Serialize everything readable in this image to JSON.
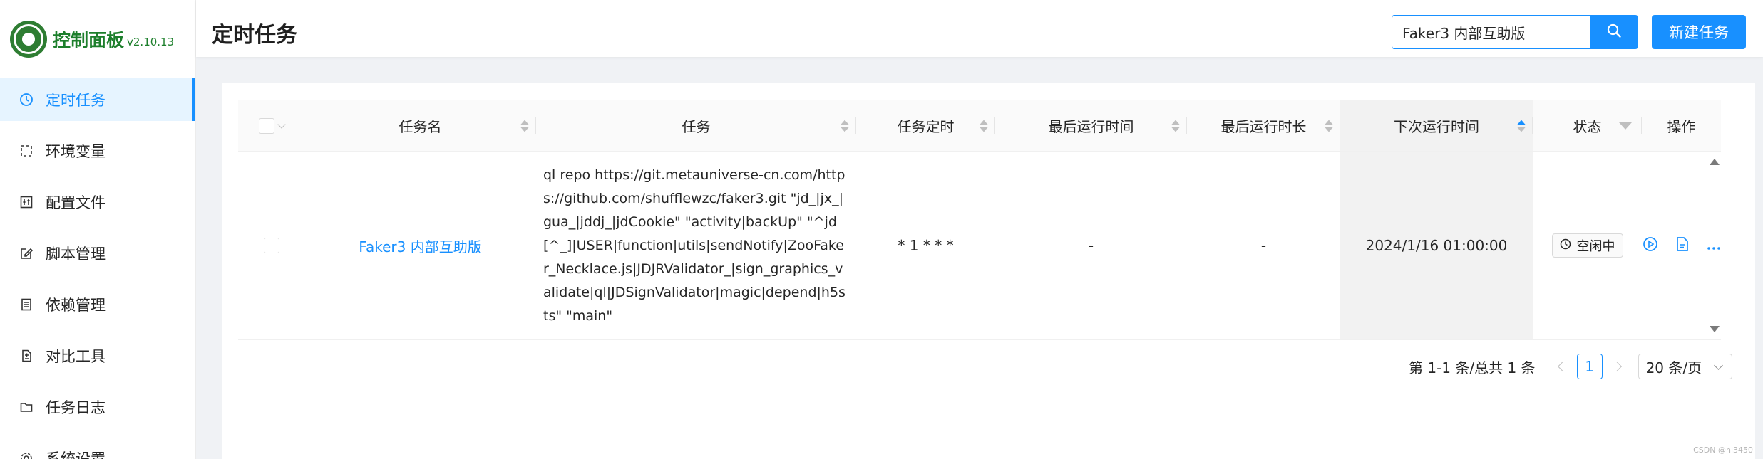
{
  "app": {
    "title": "控制面板",
    "version": "v2.10.13"
  },
  "sidebar": {
    "items": [
      {
        "label": "定时任务",
        "icon": "clock-icon",
        "active": true
      },
      {
        "label": "环境变量",
        "icon": "bracket-icon"
      },
      {
        "label": "配置文件",
        "icon": "control-icon"
      },
      {
        "label": "脚本管理",
        "icon": "edit-icon"
      },
      {
        "label": "依赖管理",
        "icon": "container-icon"
      },
      {
        "label": "对比工具",
        "icon": "diff-icon"
      },
      {
        "label": "任务日志",
        "icon": "folder-icon"
      },
      {
        "label": "系统设置",
        "icon": "setting-icon"
      }
    ]
  },
  "header": {
    "title": "定时任务",
    "search_value": "Faker3 内部互助版",
    "new_button": "新建任务"
  },
  "table": {
    "columns": [
      "任务名",
      "任务",
      "任务定时",
      "最后运行时间",
      "最后运行时长",
      "下次运行时间",
      "状态",
      "操作"
    ],
    "rows": [
      {
        "name": "Faker3 内部互助版",
        "command": "ql repo https://git.metauniverse-cn.com/https://github.com/shufflewzc/faker3.git \"jd_|jx_|gua_|jddj_|jdCookie\" \"activity|backUp\" \"^jd[^_]|USER|function|utils|sendNotify|ZooFaker_Necklace.js|JDJRValidator_|sign_graphics_validate|ql|JDSignValidator|magic|depend|h5sts\" \"main\"",
        "schedule": "* 1 * * *",
        "last_run_time": "-",
        "last_run_duration": "-",
        "next_run_time": "2024/1/16 01:00:00",
        "status": "空闲中"
      }
    ]
  },
  "pagination": {
    "total_text": "第 1-1 条/总共 1 条",
    "current_page": "1",
    "page_size": "20 条/页"
  },
  "colors": {
    "primary": "#1890ff",
    "brand_green": "#1d7f2c"
  },
  "watermark": "CSDN @hi3450"
}
